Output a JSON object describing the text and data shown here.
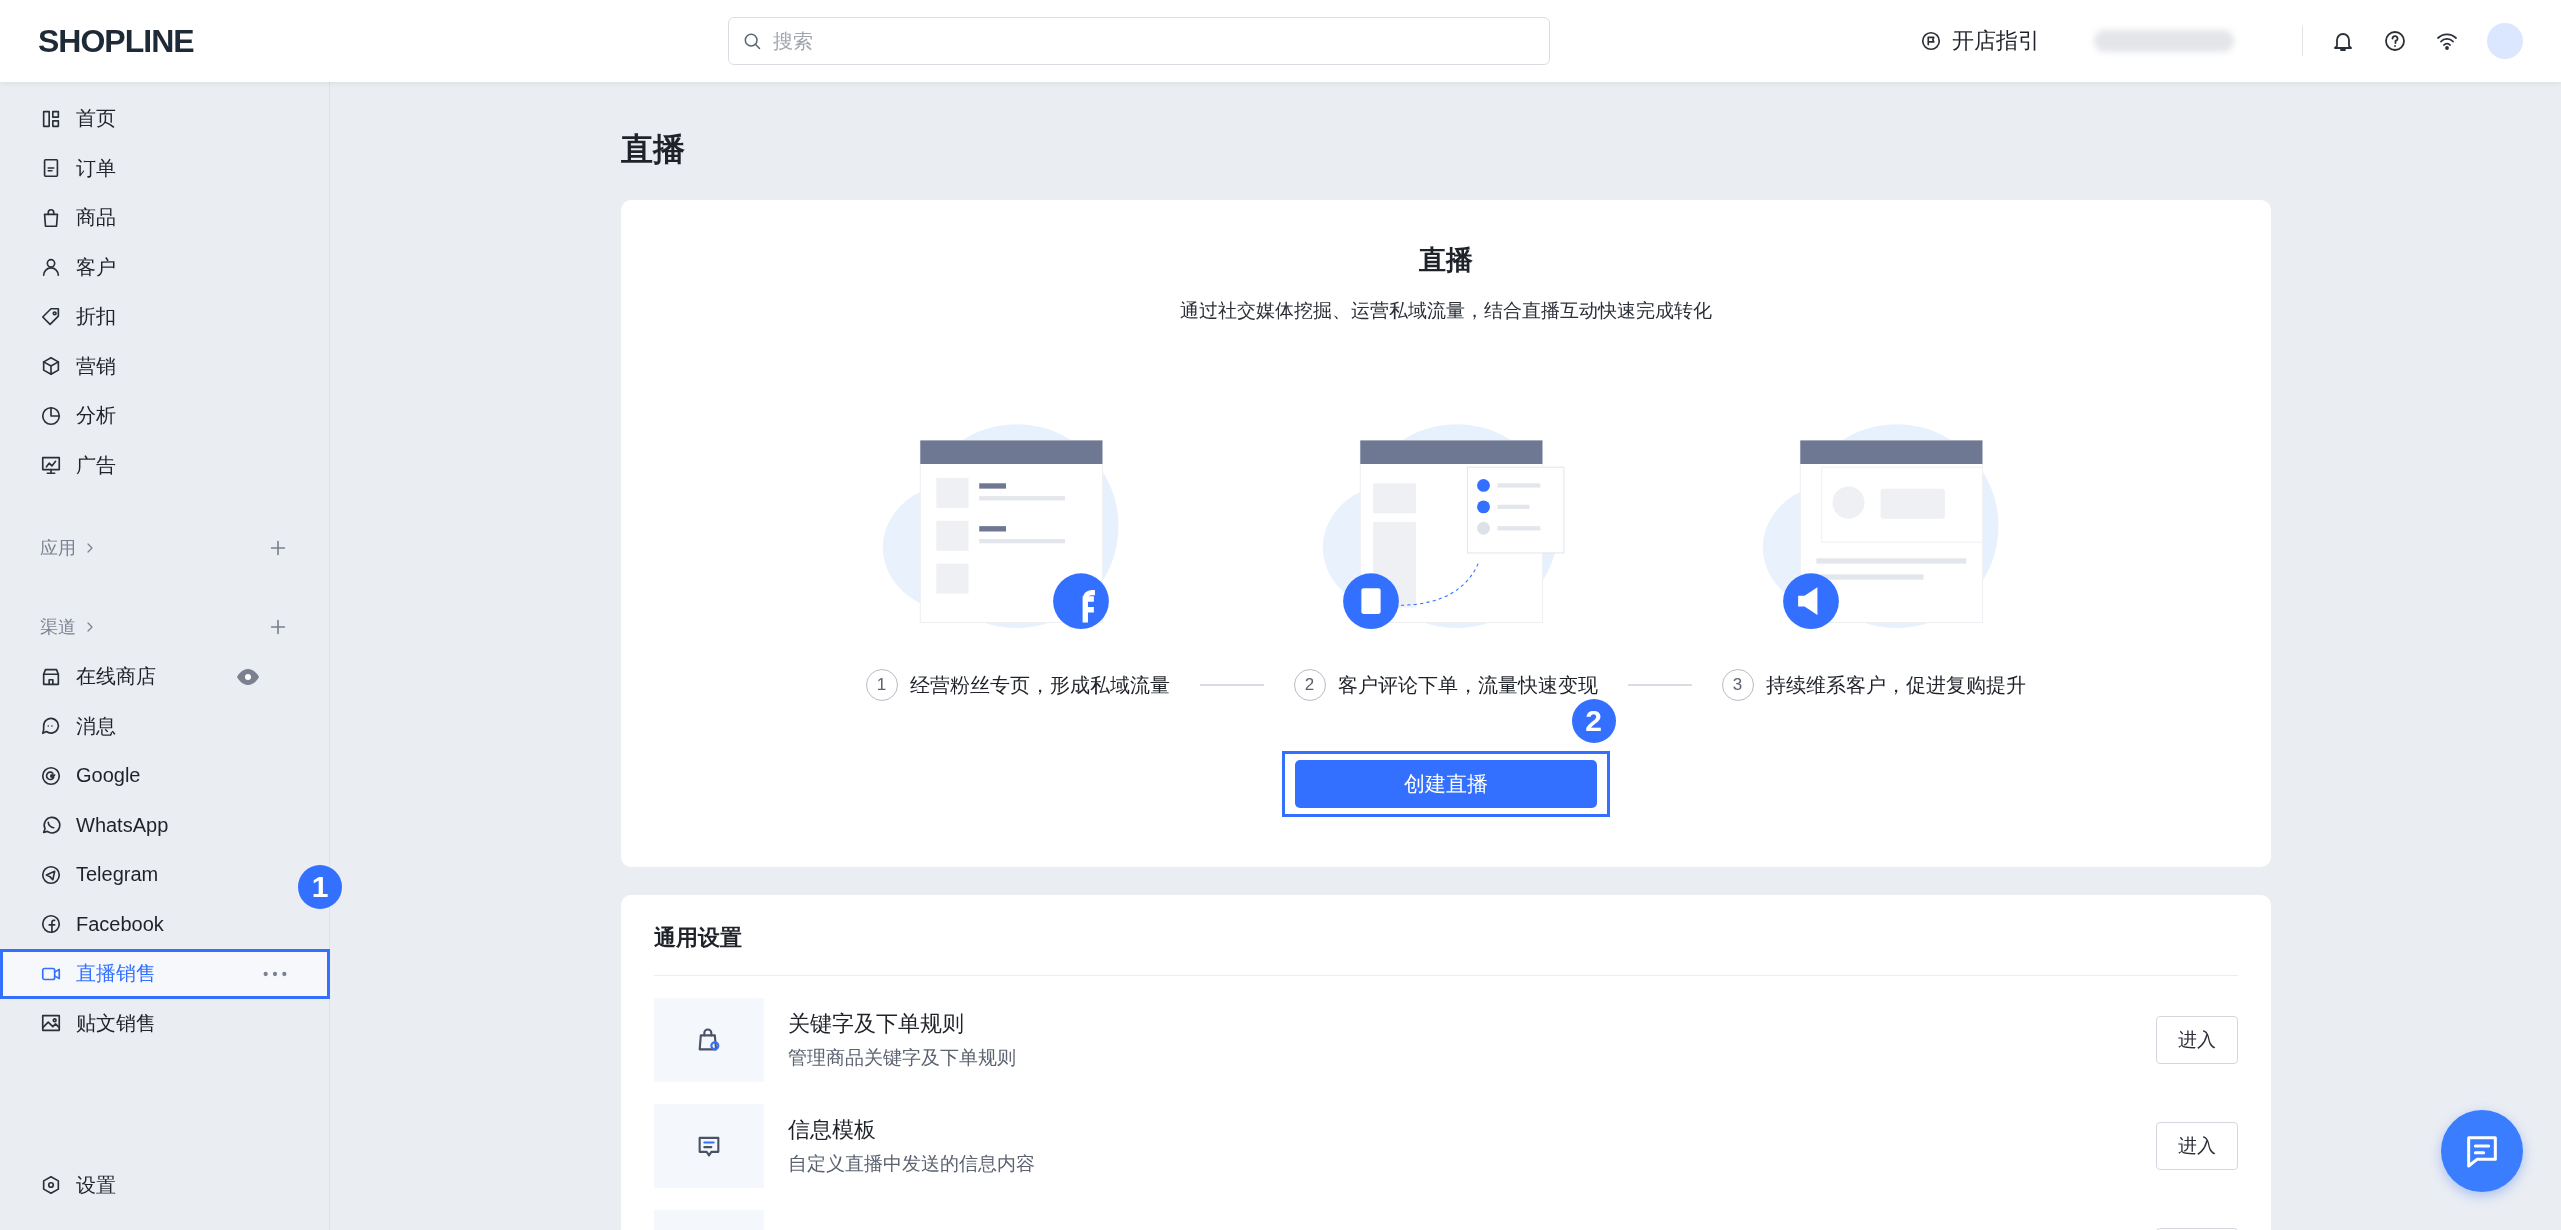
{
  "topbar": {
    "logo": "SHOPLINE",
    "search": {
      "placeholder": "搜索"
    },
    "guide": "开店指引"
  },
  "sidebar": {
    "main_items": [
      {
        "label": "首页",
        "selected": false
      },
      {
        "label": "订单",
        "selected": false
      },
      {
        "label": "商品",
        "selected": false
      },
      {
        "label": "客户",
        "selected": false
      },
      {
        "label": "折扣",
        "selected": false
      },
      {
        "label": "营销",
        "selected": false
      },
      {
        "label": "分析",
        "selected": false
      },
      {
        "label": "广告",
        "selected": false
      }
    ],
    "apps_section": "应用",
    "channels_section": "渠道",
    "channel_items": [
      {
        "label": "在线商店",
        "selected": false,
        "kind": "store"
      },
      {
        "label": "消息",
        "selected": false,
        "kind": "plain"
      },
      {
        "label": "Google",
        "selected": false,
        "kind": "plain"
      },
      {
        "label": "WhatsApp",
        "selected": false,
        "kind": "plain"
      },
      {
        "label": "Telegram",
        "selected": false,
        "kind": "plain"
      },
      {
        "label": "Facebook",
        "selected": false,
        "kind": "plain"
      },
      {
        "label": "直播销售",
        "selected": true,
        "kind": "plain",
        "callout": "1"
      },
      {
        "label": "贴文销售",
        "selected": false,
        "kind": "plain"
      }
    ],
    "settings": "设置"
  },
  "page_title": "直播",
  "intro": {
    "title": "直播",
    "subtitle": "通过社交媒体挖掘、运营私域流量，结合直播互动快速完成转化",
    "steps": [
      {
        "number": "1",
        "label": "经营粉丝专页，形成私域流量"
      },
      {
        "number": "2",
        "label": "客户评论下单，流量快速变现"
      },
      {
        "number": "3",
        "label": "持续维系客户，促进复购提升"
      }
    ],
    "button": "创建直播",
    "button_callout": "2"
  },
  "general_settings": {
    "title": "通用设置",
    "rows": [
      {
        "kind": "full",
        "title": "关键字及下单规则",
        "description": "管理商品关键字及下单规则",
        "button": "进入"
      },
      {
        "kind": "full",
        "title": "信息模板",
        "description": "自定义直播中发送的信息内容",
        "button": "进入"
      },
      {
        "kind": "partial"
      }
    ]
  }
}
